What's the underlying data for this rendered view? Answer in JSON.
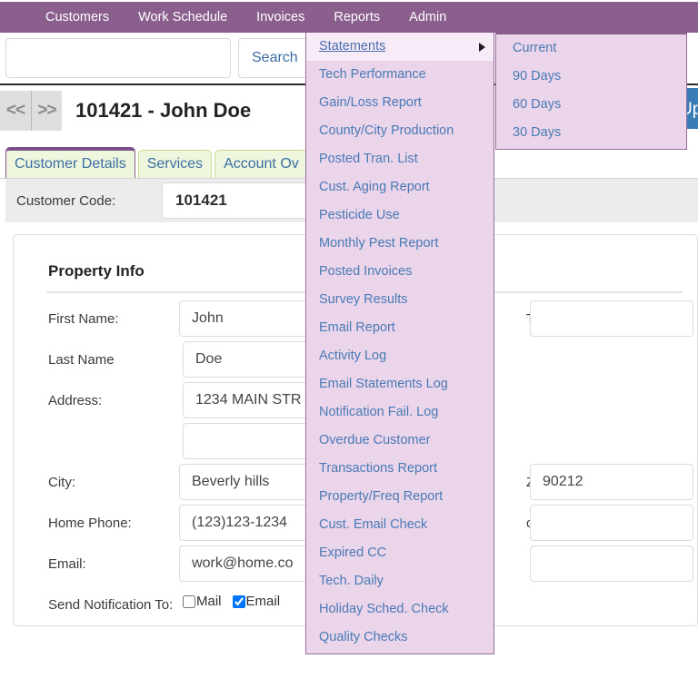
{
  "navbar": {
    "items": [
      {
        "label": "Customers",
        "active": false
      },
      {
        "label": "Work Schedule",
        "active": false
      },
      {
        "label": "Invoices",
        "active": false
      },
      {
        "label": "Reports",
        "active": true
      },
      {
        "label": "Admin",
        "active": false
      }
    ]
  },
  "search": {
    "value": "",
    "placeholder": "",
    "button_label": "Search"
  },
  "customer_header": {
    "prev_label": "<<",
    "next_label": ">>",
    "title": "101421 - John Doe",
    "update_label": "Update"
  },
  "tabs": [
    {
      "label": "Customer Details",
      "active": true
    },
    {
      "label": "Services",
      "active": false
    },
    {
      "label": "Account Ov",
      "active": false
    }
  ],
  "customer_code": {
    "label": "Customer Code:",
    "value": "101421"
  },
  "property_info": {
    "title": "Property Info",
    "fields": {
      "first_name_label": "First Name:",
      "first_name_value": "John",
      "last_name_label": "Last Name",
      "last_name_value": "Doe",
      "address_label": "Address:",
      "address_value": "1234 MAIN STR",
      "address2_value": "",
      "city_label": "City:",
      "city_value": "Beverly hills",
      "home_phone_label": "Home Phone:",
      "home_phone_value": "(123)123-1234",
      "email_label": "Email:",
      "email_value": "work@home.co",
      "send_notification_label": "Send Notification To:",
      "title_label": "Title:",
      "title_value": "",
      "zip_label": "Zip:",
      "zip_value": "90212",
      "phone_label": "one:",
      "phone_value": "",
      "phone2_value": ""
    },
    "notification": {
      "mail_label": "Mail",
      "mail_checked": false,
      "email_label": "Email",
      "email_checked": true
    }
  },
  "reports_menu": {
    "items": [
      {
        "label": "Statements",
        "hovered": true,
        "submenu": true
      },
      {
        "label": "Tech Performance",
        "hovered": false,
        "submenu": false
      },
      {
        "label": "Gain/Loss Report",
        "hovered": false,
        "submenu": false
      },
      {
        "label": "County/City Production",
        "hovered": false,
        "submenu": false
      },
      {
        "label": "Posted Tran. List",
        "hovered": false,
        "submenu": false
      },
      {
        "label": "Cust. Aging Report",
        "hovered": false,
        "submenu": false
      },
      {
        "label": "Pesticide Use",
        "hovered": false,
        "submenu": false
      },
      {
        "label": "Monthly Pest Report",
        "hovered": false,
        "submenu": false
      },
      {
        "label": "Posted Invoices",
        "hovered": false,
        "submenu": false
      },
      {
        "label": "Survey Results",
        "hovered": false,
        "submenu": false
      },
      {
        "label": "Email Report",
        "hovered": false,
        "submenu": false
      },
      {
        "label": "Activity Log",
        "hovered": false,
        "submenu": false
      },
      {
        "label": "Email Statements Log",
        "hovered": false,
        "submenu": false
      },
      {
        "label": "Notification Fail. Log",
        "hovered": false,
        "submenu": false
      },
      {
        "label": "Overdue Customer",
        "hovered": false,
        "submenu": false
      },
      {
        "label": "Transactions Report",
        "hovered": false,
        "submenu": false
      },
      {
        "label": "Property/Freq Report",
        "hovered": false,
        "submenu": false
      },
      {
        "label": "Cust. Email Check",
        "hovered": false,
        "submenu": false
      },
      {
        "label": "Expired CC",
        "hovered": false,
        "submenu": false
      },
      {
        "label": "Tech. Daily",
        "hovered": false,
        "submenu": false
      },
      {
        "label": "Holiday Sched. Check",
        "hovered": false,
        "submenu": false
      },
      {
        "label": "Quality Checks",
        "hovered": false,
        "submenu": false
      }
    ]
  },
  "statements_submenu": {
    "items": [
      {
        "label": "Current"
      },
      {
        "label": "90 Days"
      },
      {
        "label": "60 Days"
      },
      {
        "label": "30 Days"
      }
    ]
  },
  "colors": {
    "nav_bg": "#8a5f8e",
    "menu_bg": "#ead5ea",
    "menu_hover_bg": "#f7ebf7",
    "menu_text": "#4a7ab5",
    "tab_bg": "#eef6dd",
    "tab_border": "#c6dc8e",
    "update_btn": "#3a7cb5",
    "code_strip_bg": "#ececec"
  }
}
